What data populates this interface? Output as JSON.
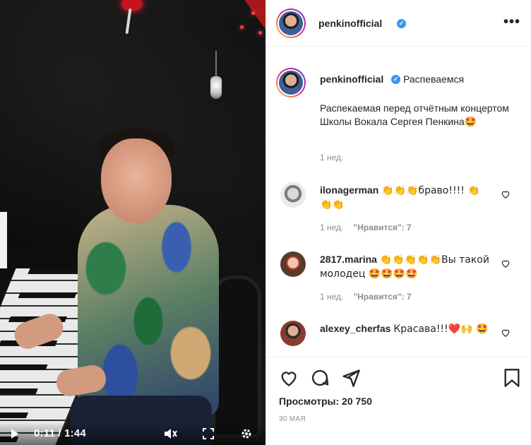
{
  "video": {
    "time": "0:11 / 1:44",
    "progress": 0.106
  },
  "post": {
    "username": "penkinofficial",
    "caption_title": "Распеваемся",
    "caption_text": "Распекаемая перед отчётным концертом Школы Вокала Сергея Пенкина",
    "caption_emoji": "🤩",
    "caption_time": "1 нед.",
    "views_label": "Просмотры: 20 750",
    "date": "30 МАЯ"
  },
  "comments": [
    {
      "user": "ilonagerman",
      "text": "👏👏👏браво!!!! 👏👏👏",
      "time": "1 нед.",
      "likes": "\"Нравится\": 7"
    },
    {
      "user": "2817.marina",
      "text": "👏👏👏👏👏Вы такой молодец 🤩🤩🤩🤩",
      "time": "1 нед.",
      "likes": "\"Нравится\": 7"
    },
    {
      "user": "alexey_cherfas",
      "text": "Красава!!!❤️🙌 🤩"
    }
  ],
  "icons": {
    "more": "more-icon",
    "heart": "heart-icon",
    "comment": "comment-icon",
    "share": "share-icon",
    "save": "bookmark-icon",
    "play": "play-icon",
    "mute": "mute-icon",
    "fullscreen": "fullscreen-icon",
    "settings": "settings-icon"
  },
  "colors": {
    "verified": "#3897f0",
    "text": "#262626",
    "muted": "#8e8e8e"
  }
}
